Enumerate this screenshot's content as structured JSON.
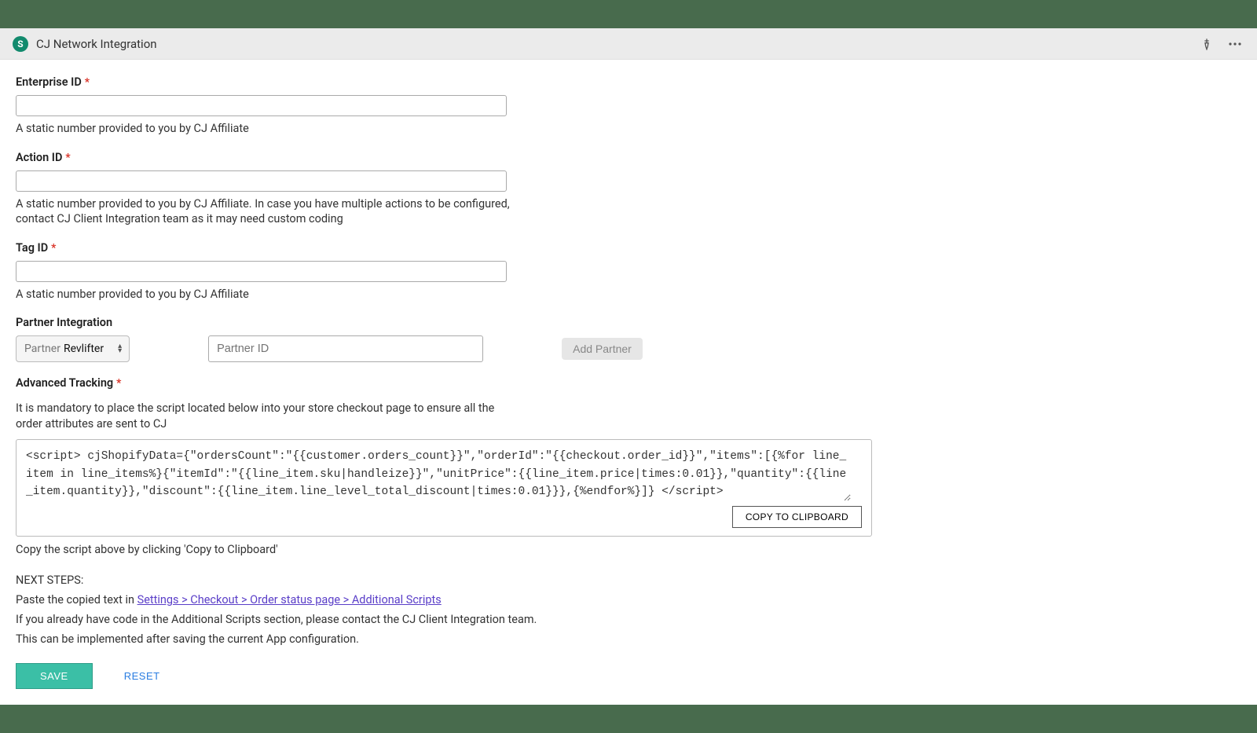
{
  "header": {
    "logo_letter": "S",
    "title": "CJ Network Integration"
  },
  "fields": {
    "enterprise_id": {
      "label": "Enterprise ID",
      "value": "",
      "help": "A static number provided to you by CJ Affiliate"
    },
    "action_id": {
      "label": "Action ID",
      "value": "",
      "help": "A static number provided to you by CJ Affiliate. In case you have multiple actions to be configured, contact CJ Client Integration team as it may need custom coding"
    },
    "tag_id": {
      "label": "Tag ID",
      "value": "",
      "help": "A static number provided to you by CJ Affiliate"
    }
  },
  "partner": {
    "section_label": "Partner Integration",
    "select_label": "Partner",
    "select_value": "Revlifter",
    "id_placeholder": "Partner ID",
    "add_label": "Add Partner"
  },
  "advanced": {
    "label": "Advanced Tracking",
    "desc": "It is mandatory to place the script located below into your store checkout page to ensure all the order attributes are sent to CJ",
    "script": "<script> cjShopifyData={\"ordersCount\":\"{{customer.orders_count}}\",\"orderId\":\"{{checkout.order_id}}\",\"items\":[{%for line_item in line_items%}{\"itemId\":\"{{line_item.sku|handleize}}\",\"unitPrice\":{{line_item.price|times:0.01}},\"quantity\":{{line_item.quantity}},\"discount\":{{line_item.line_level_total_discount|times:0.01}}},{%endfor%}]} </script>",
    "copy_label": "COPY TO CLIPBOARD",
    "copy_hint": "Copy the script above by clicking 'Copy to Clipboard'"
  },
  "next_steps": {
    "heading": "NEXT STEPS:",
    "line1_prefix": "Paste the copied text in ",
    "line1_link": "Settings > Checkout > Order status page > Additional Scripts",
    "line2": "If you already have code in the Additional Scripts section, please contact the CJ Client Integration team.",
    "line3": "This can be implemented after saving the current App configuration."
  },
  "actions": {
    "save": "SAVE",
    "reset": "RESET"
  },
  "required_marker": "*"
}
